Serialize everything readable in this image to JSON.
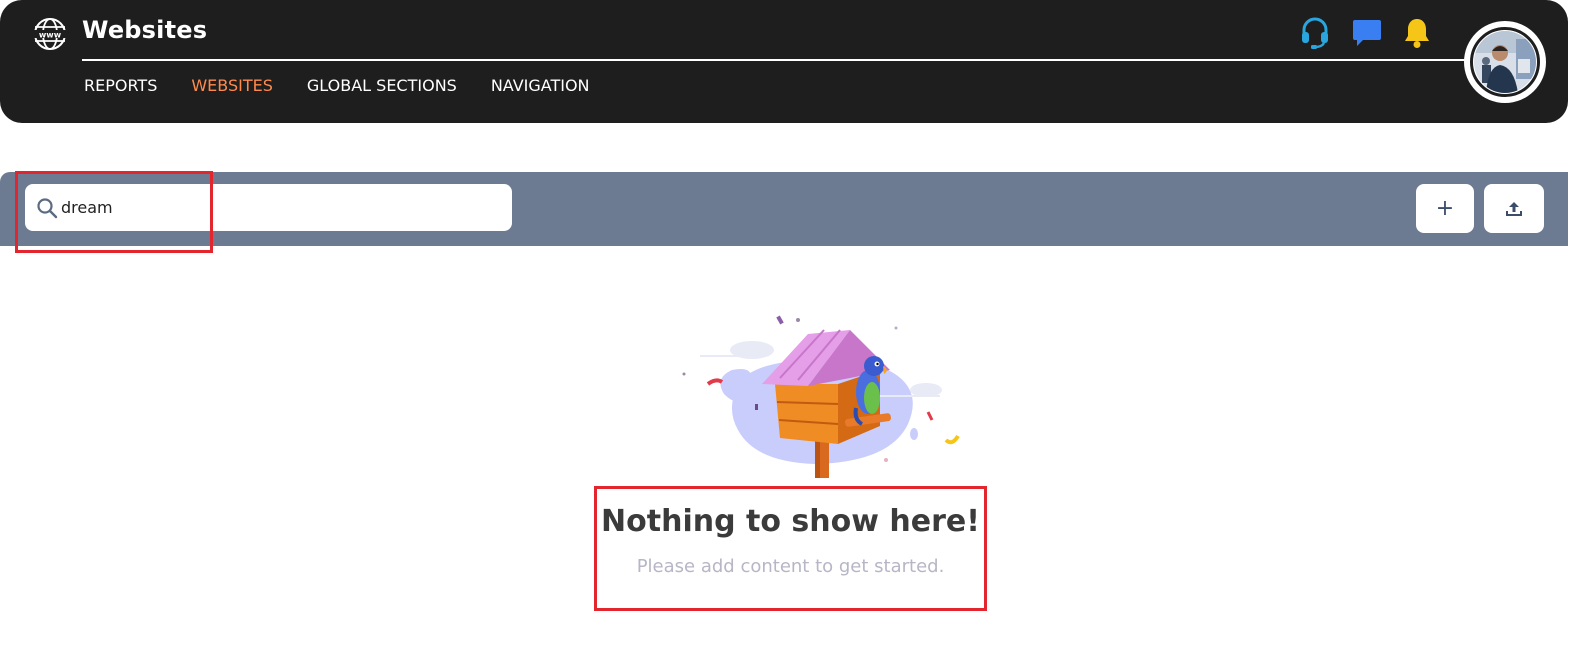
{
  "header": {
    "title": "Websites",
    "nav": [
      {
        "label": "REPORTS",
        "active": false
      },
      {
        "label": "WEBSITES",
        "active": true
      },
      {
        "label": "GLOBAL SECTIONS",
        "active": false
      },
      {
        "label": "NAVIGATION",
        "active": false
      }
    ],
    "icons": [
      "globe-icon",
      "headset-icon",
      "chat-icon",
      "bell-icon"
    ],
    "colors": {
      "background": "#1e1e1e",
      "active_nav": "#ff8a4c",
      "headset": "#2aa6df",
      "chat": "#3a7ff2",
      "bell": "#f5c518"
    }
  },
  "toolbar": {
    "search": {
      "value": "dream",
      "icon": "search-icon"
    },
    "buttons": [
      {
        "name": "add",
        "icon": "plus-icon"
      },
      {
        "name": "upload",
        "icon": "upload-icon"
      }
    ],
    "colors": {
      "background": "#6c7a92"
    }
  },
  "empty_state": {
    "title": "Nothing to show here!",
    "subtitle": "Please add content to get started.",
    "illustration": "birdhouse-parrot-illustration"
  },
  "highlights": {
    "color": "#e3262e"
  }
}
